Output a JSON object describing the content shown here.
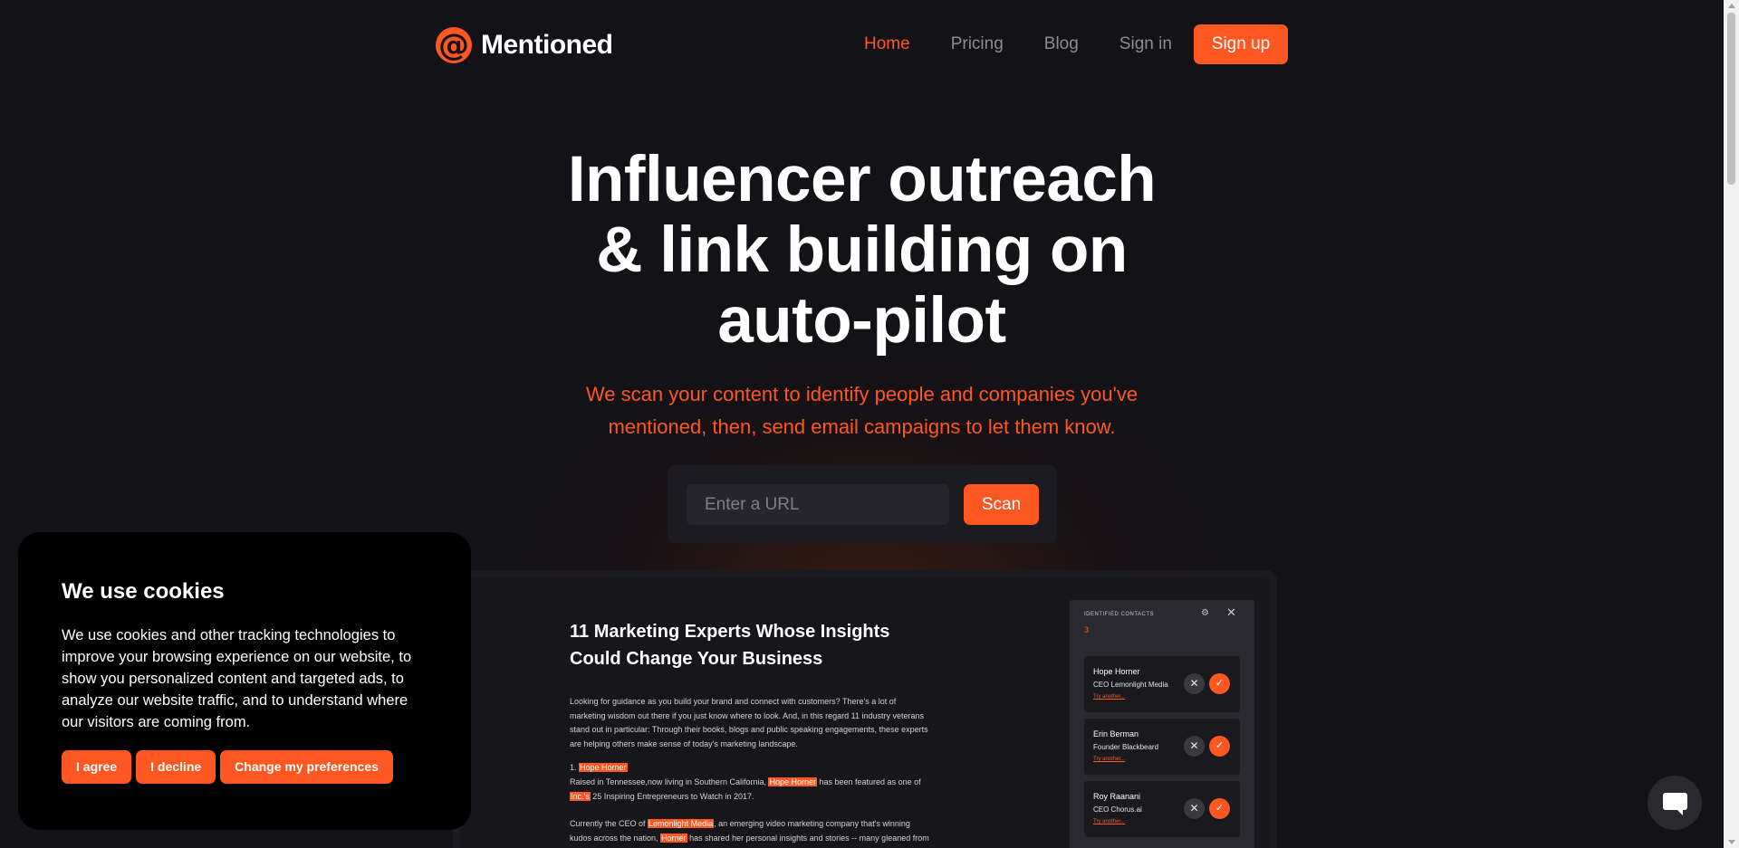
{
  "brand": {
    "name": "Mentioned",
    "mark": "@"
  },
  "nav": {
    "links": [
      "Home",
      "Pricing",
      "Blog",
      "Sign in"
    ],
    "active": "Home",
    "signup": "Sign up"
  },
  "hero": {
    "title_lines": [
      "Influencer outreach",
      "& link building on",
      "auto-pilot"
    ],
    "subtitle_lines": [
      "We scan your content to identify people and companies you've",
      "mentioned, then, send email campaigns to let them know."
    ],
    "input_placeholder": "Enter a URL",
    "scan_label": "Scan"
  },
  "preview": {
    "article_title": "11 Marketing Experts Whose Insights Could Change Your Business",
    "intro": "Looking for guidance as you build your brand and connect with customers? There's a lot of marketing wisdom out there if you just know where to look. And, in this regard 11 industry veterans stand out in particular: Through their books, blogs and public speaking engagements, these experts are helping others make sense of today's marketing landscape.",
    "item_number": "1. ",
    "item_name": "Hope Horner",
    "p2_a": "Raised in Tennessee,now living in Southern California, ",
    "p2_hl1": "Hope Horner",
    "p2_b": " has been featured as one of ",
    "p2_hl2": "Inc.'s",
    "p2_c": " 25 Inspiring Entrepreneurs to Watch in 2017.",
    "p3_a": "Currently the CEO of ",
    "p3_hl1": "Lemonlight Media",
    "p3_b": ", an emerging video marketing company that's winning kudos across the nation, ",
    "p3_hl2": "Horner",
    "p3_c": " has shared her personal insights and stories -- many gleaned from her",
    "contacts_title": "IDENTIFIED CONTACTS",
    "contacts_count": "3",
    "contacts": [
      {
        "name": "Hope Horner",
        "role": "CEO Lemonlight Media",
        "link": "Try another..."
      },
      {
        "name": "Erin Berman",
        "role": "Founder Blackbeard",
        "link": "Try another..."
      },
      {
        "name": "Roy Raanani",
        "role": "CEO Chorus.ai",
        "link": "Try another..."
      }
    ]
  },
  "cookie": {
    "title": "We use cookies",
    "text": "We use cookies and other tracking technologies to improve your browsing experience on our website, to show you personalized content and targeted ads, to analyze our website traffic, and to understand where our visitors are coming from.",
    "agree": "I agree",
    "decline": "I decline",
    "prefs": "Change my preferences"
  },
  "colors": {
    "accent": "#ff5722",
    "background": "#131217"
  },
  "icons": {
    "settings": "gear-icon",
    "close": "close-icon",
    "reject": "x-icon",
    "accept": "check-icon",
    "chat": "chat-icon"
  }
}
